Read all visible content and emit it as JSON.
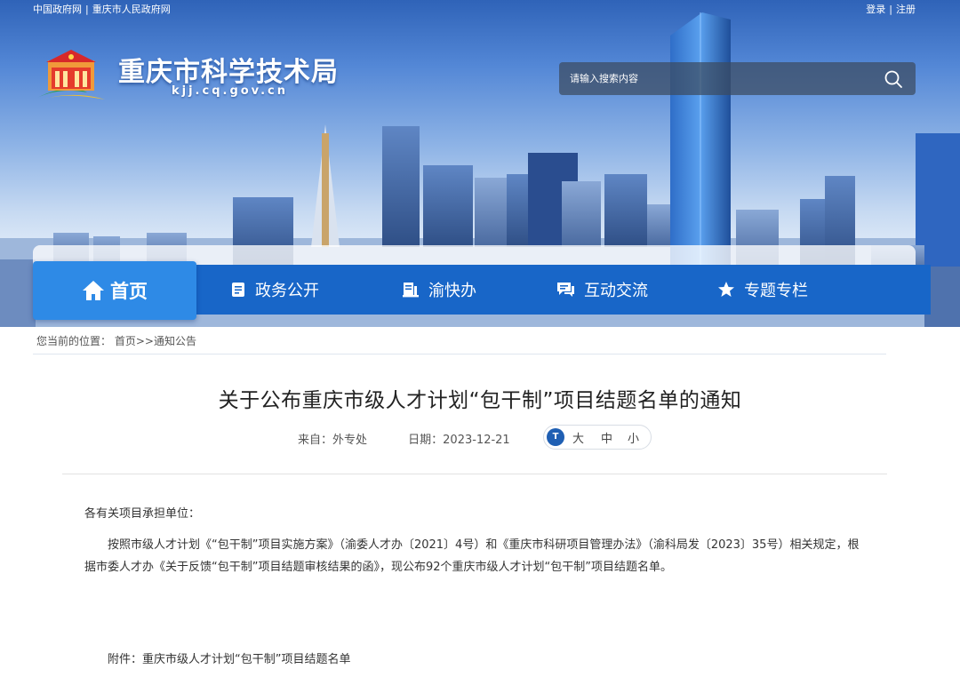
{
  "topbar": {
    "left_links": [
      "中国政府网",
      "重庆市人民政府网"
    ],
    "separator": "|",
    "login": "登录",
    "register": "注册"
  },
  "header": {
    "site_title": "重庆市科学技术局",
    "site_domain": "kjj.cq.gov.cn",
    "search_placeholder": "请输入搜索内容"
  },
  "nav": {
    "items": [
      {
        "label": "首页",
        "icon": "home-icon",
        "active": true
      },
      {
        "label": "政务公开",
        "icon": "document-icon"
      },
      {
        "label": "渝快办",
        "icon": "book-icon"
      },
      {
        "label": "互动交流",
        "icon": "chat-icon"
      },
      {
        "label": "专题专栏",
        "icon": "star-icon"
      }
    ]
  },
  "breadcrumb": {
    "prefix": "您当前的位置：",
    "home": "首页",
    "sep": ">>",
    "current": "通知公告"
  },
  "article": {
    "title": "关于公布重庆市级人才计划“包干制”项目结题名单的通知",
    "source": "来自：外专处",
    "date": "日期：2023-12-21",
    "font_size": {
      "icon_text": "T",
      "large": "大",
      "medium": "中",
      "small": "小"
    },
    "salutation": "各有关项目承担单位：",
    "body": "按照市级人才计划《“包干制”项目实施方案》（渝委人才办〔2021〕4号）和《重庆市科研项目管理办法》（渝科局发〔2023〕35号）相关规定，根据市委人才办《关于反馈“包干制”项目结题审核结果的函》，现公布92个重庆市级人才计划“包干制”项目结题名单。",
    "attachment": "附件：重庆市级人才计划“包干制”项目结题名单"
  },
  "colors": {
    "nav_bg": "#1866c8",
    "nav_active": "#2e8ae6",
    "fontsize_icon": "#1f5fb3"
  }
}
